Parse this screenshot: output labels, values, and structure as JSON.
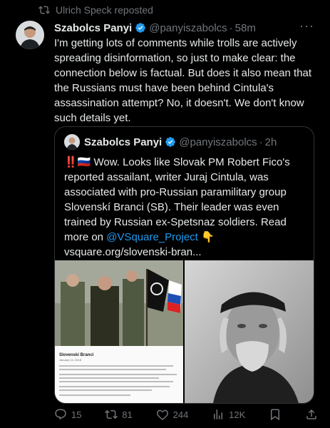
{
  "repost": {
    "label": "Ulrich Speck reposted"
  },
  "tweet": {
    "name": "Szabolcs Panyi",
    "handle": "@panyiszabolcs",
    "time": "58m",
    "text": "I'm getting lots of comments while trolls are actively spreading disinformation, so just to make clear: the connection below is factual. But does it also mean that the Russians must have been behind Cintula's assassination attempt? No, it doesn't. We don't know such details yet."
  },
  "quote": {
    "name": "Szabolcs Panyi",
    "handle": "@panyiszabolcs",
    "time": "2h",
    "text_before": "‼️🇷🇺 Wow. Looks like Slovak PM Robert Fico's reported assailant, writer Juraj Cintula, was associated with pro-Russian paramilitary group Slovenskí Branci (SB). Their leader was even trained by Russian ex-Spetsnaz soldiers. Read more on ",
    "mention": "@VSquare_Project",
    "text_after": " 👇",
    "link": "vsquare.org/slovenski-bran...",
    "image_left_caption": "Slovenskí Branci",
    "image_left_date": "January 14, 2018"
  },
  "actions": {
    "replies": "15",
    "reposts": "81",
    "likes": "244",
    "views": "12K"
  },
  "colors": {
    "accent": "#1d9bf0",
    "repost_active": "#00ba7c",
    "muted": "#71767b"
  }
}
